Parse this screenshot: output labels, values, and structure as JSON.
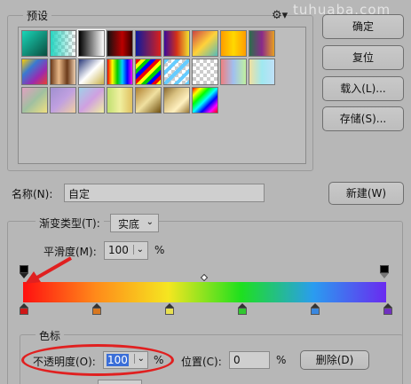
{
  "watermark": "tuhuaba.com",
  "presets": {
    "title": "预设",
    "swatches": [
      "linear-gradient(135deg,#1ad6b8,#0a4d3f)",
      "CHECKER:linear-gradient(90deg,#27d4c0,rgba(39,212,192,0))",
      "linear-gradient(90deg,#000,#fff)",
      "linear-gradient(90deg,#111,#b00 60%,#300)",
      "linear-gradient(90deg,#0c1aa0,#d8201c)",
      "linear-gradient(90deg,#3a0a9c,#d43018,#f0e030)",
      "linear-gradient(135deg,#c44,#ffd23a,#5bb)",
      "linear-gradient(90deg,#ff9c00,#ffd800,#ff9c00)",
      "linear-gradient(90deg,#2a6e4a,#8a2a8a,#e8a020)",
      "linear-gradient(135deg,#ffcc00,#3a7ad0,#9a2ab0,#e84030)",
      "linear-gradient(90deg,#6b3a1a,#e8b888,#6b3a1a,#f0d0b0)",
      "linear-gradient(135deg,#2a3a7a,#ffffff,#c8b048)",
      "linear-gradient(90deg,#e00,#ff0,#0c0,#0cf,#00f,#f0f)",
      "CHECKER:repeating-linear-gradient(135deg,#e00 0 4px,#ff0 4px 8px,#0c0 8px 12px,#00f 12px 16px)",
      "CHECKER:repeating-linear-gradient(135deg,#6cf 0 4px,transparent 4px 9px)",
      "CHECKER:linear-gradient(90deg,rgba(255,255,255,0),rgba(255,255,255,0))",
      "linear-gradient(90deg,#f08080,#a0c0f0,#c0f0a0)",
      "linear-gradient(90deg,#f0e0a0,#a0e8f0,#c0e0f8)",
      "linear-gradient(135deg,#e0a0c0,#a0c0a0,#f0e080)",
      "linear-gradient(135deg,#a090d0,#c0a0e0,#f0d0a0)",
      "linear-gradient(135deg,#a0d0e8,#d0a0e0,#f0f0a0)",
      "linear-gradient(90deg,#c0e070,#f0f0a0,#e0c060)",
      "linear-gradient(135deg,#b08030,#f0e0a0,#705010)",
      "linear-gradient(135deg,#8a6a30,#d8c080,#fff0c0,#9a7a38)",
      "linear-gradient(135deg,#f00,#ff0,#0f0,#0ff,#00f,#f0f,#f00)"
    ]
  },
  "buttons": {
    "ok": "确定",
    "reset": "复位",
    "load": "载入(L)...",
    "save": "存储(S)...",
    "new": "新建(W)",
    "delete": "删除(D)"
  },
  "name_field": {
    "label": "名称(N):",
    "value": "自定"
  },
  "gradient": {
    "type_label": "渐变类型(T):",
    "type_value": "实底",
    "smooth_label": "平滑度(M):",
    "smooth_value": "100",
    "smooth_unit": "%",
    "bar_gradient": "linear-gradient(90deg,#ff1010 0%,#ff8a1a 20%,#f5e620 40%,#1ee01e 60%,#2a9cf0 80%,#6a2af0 100%)",
    "color_stops": [
      "#d01818",
      "#d87820",
      "#e8e050",
      "#30c830",
      "#3a88e0",
      "#7030c0"
    ]
  },
  "color_stop_section": {
    "title": "色标",
    "opacity_label": "不透明度(O):",
    "opacity_value": "100",
    "opacity_unit": "%",
    "position_label": "位置(C):",
    "position_value": "0",
    "position_unit": "%"
  },
  "annotation_color": "#e02020"
}
